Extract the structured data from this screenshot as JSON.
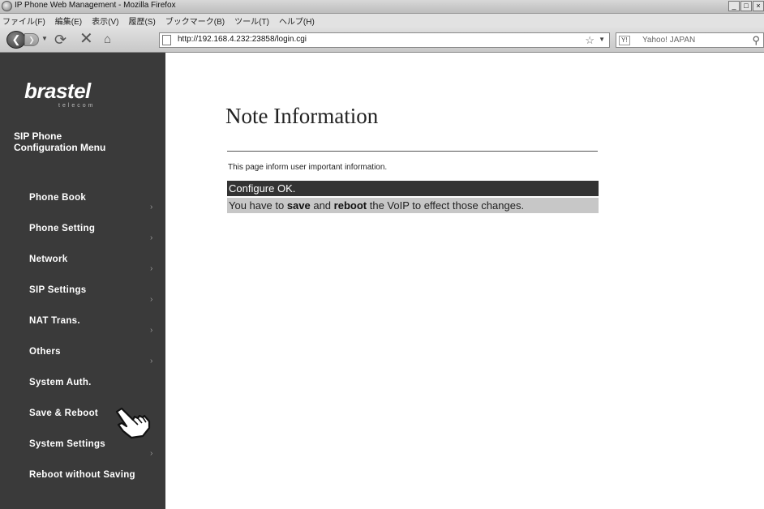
{
  "window": {
    "title": "IP Phone Web Management - Mozilla Firefox",
    "controls": [
      "_",
      "□",
      "×"
    ]
  },
  "menubar": [
    "ファイル(F)",
    "編集(E)",
    "表示(V)",
    "履歴(S)",
    "ブックマーク(B)",
    "ツール(T)",
    "ヘルプ(H)"
  ],
  "navbar": {
    "url": "http://192.168.4.232:23858/login.cgi",
    "search_placeholder": "Yahoo! JAPAN",
    "search_engine": "Y!"
  },
  "sidebar": {
    "logo": "brastel",
    "logo_sub": "telecom",
    "title_line1": "SIP Phone",
    "title_line2": "Configuration Menu",
    "items": [
      {
        "label": "Phone Book",
        "has_arrow": true
      },
      {
        "label": "Phone Setting",
        "has_arrow": true
      },
      {
        "label": "Network",
        "has_arrow": true
      },
      {
        "label": "SIP Settings",
        "has_arrow": true
      },
      {
        "label": "NAT Trans.",
        "has_arrow": true
      },
      {
        "label": "Others",
        "has_arrow": true
      },
      {
        "label": "System Auth.",
        "has_arrow": false
      },
      {
        "label": "Save & Reboot",
        "has_arrow": false
      },
      {
        "label": "System Settings",
        "has_arrow": true
      },
      {
        "label": "Reboot without Saving",
        "has_arrow": false
      }
    ]
  },
  "main": {
    "title": "Note Information",
    "intro": "This page inform user important information.",
    "status": "Configure OK.",
    "message_parts": {
      "p1": "You have to ",
      "save": "save",
      "p2": " and ",
      "reboot": "reboot",
      "p3": " the VoIP to effect those changes."
    }
  },
  "colors": {
    "sidebar_bg": "#3a3a3a",
    "status_bg": "#333333",
    "message_bg": "#c7c7c7"
  }
}
